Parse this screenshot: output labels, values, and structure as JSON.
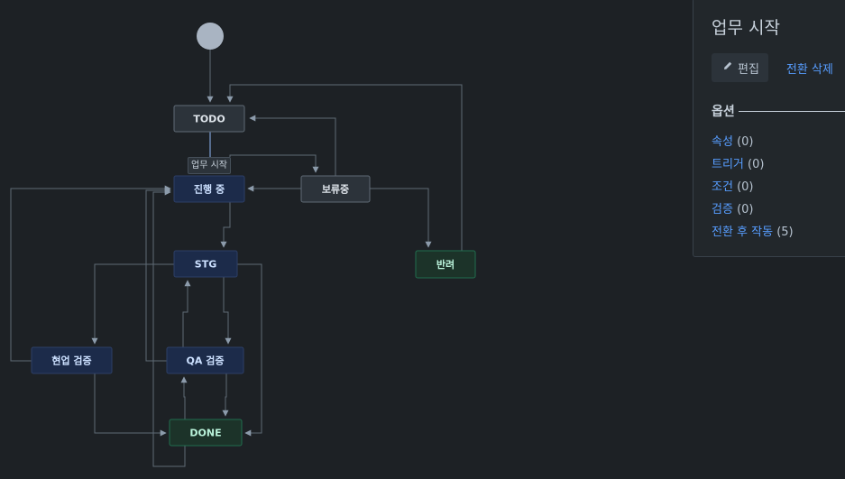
{
  "diagram": {
    "nodes": [
      {
        "id": "todo",
        "label": "TODO",
        "status": "todo"
      },
      {
        "id": "inprogress",
        "label": "진행 중",
        "status": "progress"
      },
      {
        "id": "hold",
        "label": "보류중",
        "status": "todo"
      },
      {
        "id": "stg",
        "label": "STG",
        "status": "progress"
      },
      {
        "id": "reject",
        "label": "반려",
        "status": "done"
      },
      {
        "id": "fieldcheck",
        "label": "현업 검증",
        "status": "progress"
      },
      {
        "id": "qacheck",
        "label": "QA 검증",
        "status": "progress"
      },
      {
        "id": "done",
        "label": "DONE",
        "status": "done"
      }
    ],
    "selected_transition_label": "업무 시작"
  },
  "panel": {
    "title": "업무 시작",
    "edit_label": "편집",
    "delete_label": "전환 삭제",
    "options_header": "옵션",
    "options": [
      {
        "label": "속성",
        "count": "(0)"
      },
      {
        "label": "트리거",
        "count": "(0)"
      },
      {
        "label": "조건",
        "count": "(0)"
      },
      {
        "label": "검증",
        "count": "(0)"
      },
      {
        "label": "전환 후 작동",
        "count": "(5)"
      }
    ]
  },
  "colors": {
    "background": "#1d2125",
    "todo_fill": "#2c333a",
    "todo_stroke": "#5f6a75",
    "todo_text": "#dee4ea",
    "progress_fill": "#1c2b4a",
    "progress_stroke": "#2d3f66",
    "progress_text": "#cce0ff",
    "done_fill": "#1c3329",
    "done_stroke": "#216e4e",
    "done_text": "#baf3db",
    "link": "#579dff"
  }
}
